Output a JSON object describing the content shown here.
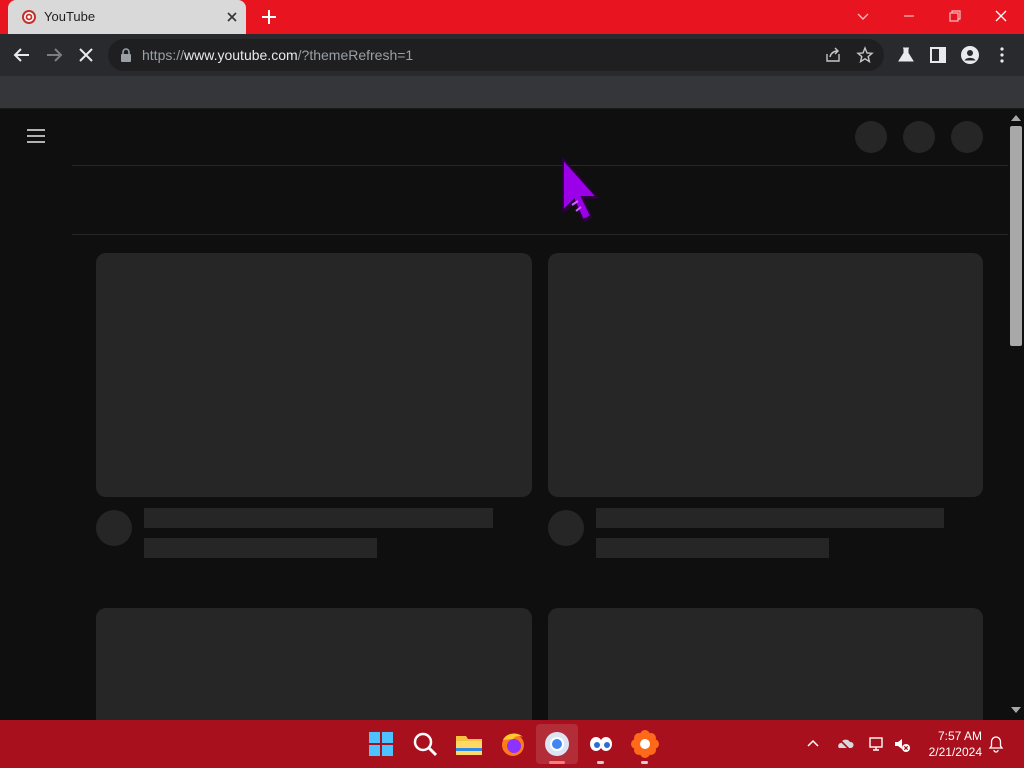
{
  "browser": {
    "tab": {
      "title": "YouTube"
    },
    "address": {
      "scheme": "https://",
      "host": "www.youtube.com",
      "path": "/?themeRefresh=1"
    }
  },
  "taskbar": {
    "apps": [
      "start-icon",
      "search-icon",
      "file-explorer-icon",
      "firefox-icon",
      "chrome-icon",
      "eyes-app-icon",
      "flower-app-icon"
    ],
    "clock": {
      "time": "7:57 AM",
      "date": "2/21/2024"
    }
  },
  "colors": {
    "tabstrip": "#e8141f",
    "taskbar": "#a8101d",
    "page_bg": "#0f0f0f",
    "skeleton": "#262626",
    "cursor": "#9b00e8"
  }
}
